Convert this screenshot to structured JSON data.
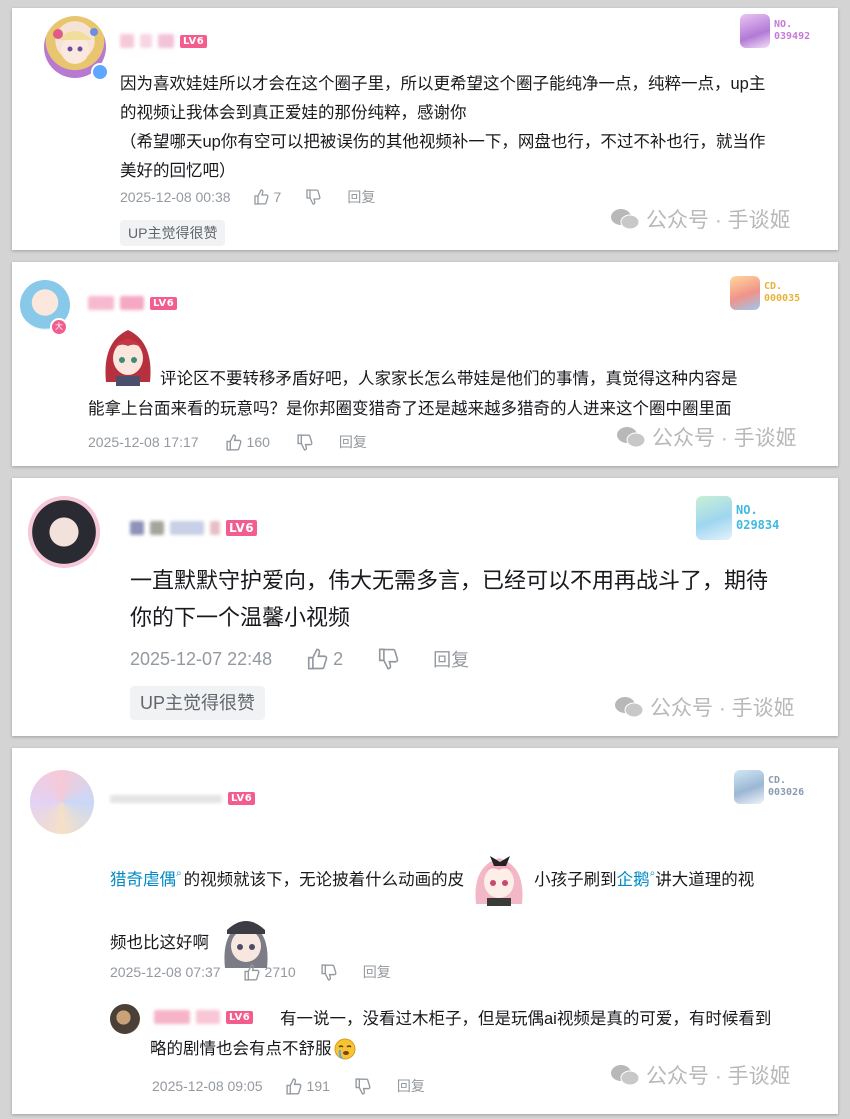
{
  "comments": [
    {
      "level": "LV6",
      "badge": {
        "line1": "NO.",
        "line2": "039492",
        "color": "#c57ad6"
      },
      "text_lines": [
        "因为喜欢娃娃所以才会在这个圈子里，所以更希望这个圈子能纯净一点，纯粹一点，up主",
        "的视频让我体会到真正爱娃的那份纯粹，感谢你",
        "（希望哪天up你有空可以把被误伤的其他视频补一下，网盘也行，不过不补也行，就当作",
        "美好的回忆吧）"
      ],
      "time": "2025-12-08 00:38",
      "likes": "7",
      "reply": "回复",
      "tag": "UP主觉得很赞",
      "watermark": "公众号 · 手谈姬"
    },
    {
      "level": "LV6",
      "badge": {
        "line1": "CD.",
        "line2": "000035",
        "color": "#e9b23a"
      },
      "text_lines": [
        "评论区不要转移矛盾好吧，人家家长怎么带娃是他们的事情，真觉得这种内容是",
        "能拿上台面来看的玩意吗？是你邦圈变猎奇了还是越来越多猎奇的人进来这个圈中圈里面"
      ],
      "time": "2025-12-08 17:17",
      "likes": "160",
      "reply": "回复",
      "watermark": "公众号 · 手谈姬"
    },
    {
      "level": "LV6",
      "badge": {
        "line1": "NO.",
        "line2": "029834",
        "color": "#3fb9e0"
      },
      "text_lines": [
        "一直默默守护爱向，伟大无需多言，已经可以不用再战斗了，期待",
        "你的下一个温馨小视频"
      ],
      "time": "2025-12-07 22:48",
      "likes": "2",
      "reply": "回复",
      "tag": "UP主觉得很赞",
      "watermark": "公众号 · 手谈姬"
    },
    {
      "level": "LV6",
      "badge": {
        "line1": "CD.",
        "line2": "003026",
        "color": "#8a9bb0"
      },
      "line1_link1": "猎奇虐偶",
      "line1_mid": "的视频就该下，无论披着什么动画的皮",
      "line1_mid2": "小孩子刷到",
      "line1_link2": "企鹅",
      "line1_end": "讲大道理的视",
      "line2": "频也比这好啊",
      "time": "2025-12-08 07:37",
      "likes": "2710",
      "reply": "回复",
      "sub_reply": {
        "level": "LV6",
        "text_line1": "有一说一，没看过木柜子，但是玩偶ai视频是真的可爱，有时候看到",
        "text_line2": "略的剧情也会有点不舒服",
        "time": "2025-12-08 09:05",
        "likes": "191",
        "reply": "回复"
      },
      "watermark": "公众号 · 手谈姬"
    }
  ]
}
